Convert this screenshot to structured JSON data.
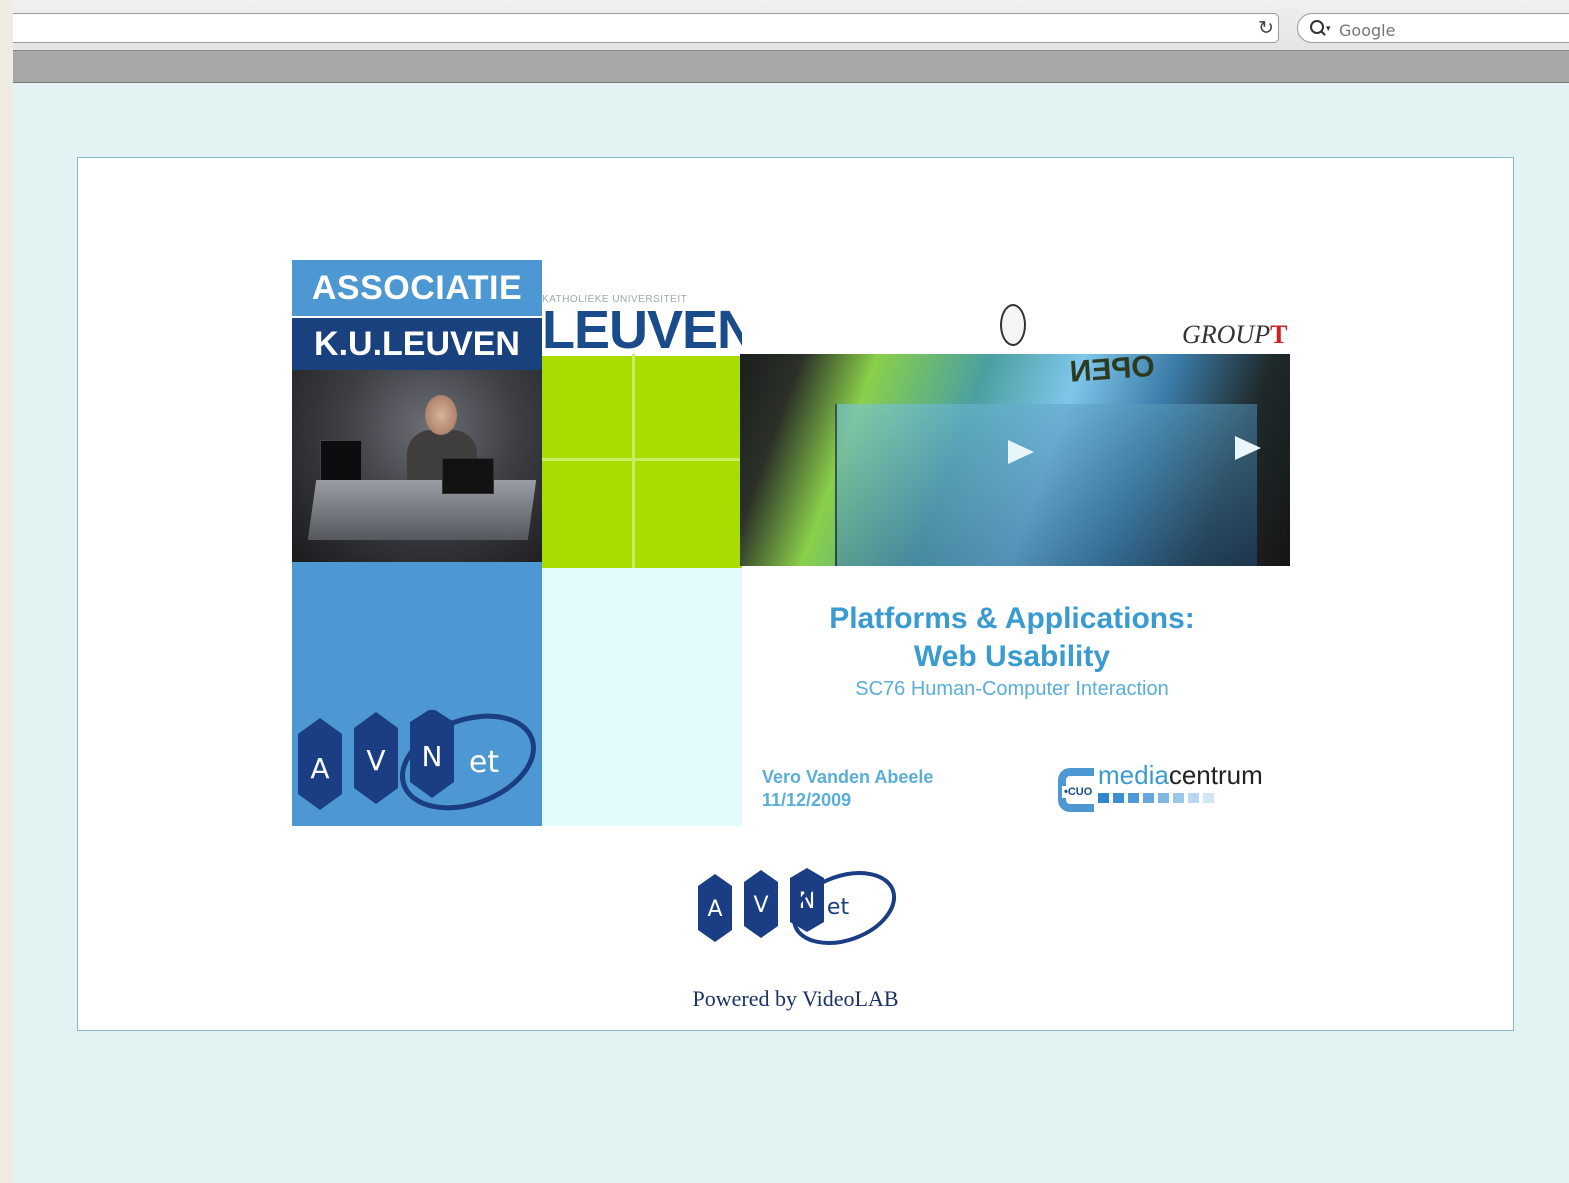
{
  "browser": {
    "url": "",
    "search": {
      "placeholder": "Google",
      "value": ""
    },
    "reload_icon": "reload-icon",
    "search_icon": "search-icon"
  },
  "slide": {
    "assoc_word": "ASSOCIATIE",
    "kul_word": "K.U.LEUVEN",
    "univ_small": "KATHOLIEKE UNIVERSITEIT",
    "univ_big": "LEUVEN",
    "photo_sign": "OPEN",
    "groupt_logo": {
      "text": "GROUP",
      "accent": "T"
    },
    "title_line1": "Platforms & Applications:",
    "title_line2": "Web Usability",
    "subtitle": "SC76 Human-Computer  Interaction",
    "presenter": "Vero Vanden Abeele",
    "date": "11/12/2009",
    "mediacentrum": {
      "media": "media",
      "centrum": "centrum",
      "cuo": "•CUO"
    },
    "avnet_logo": {
      "a": "A",
      "v": "V",
      "n": "N",
      "et": "et"
    }
  },
  "footer": {
    "avnet_logo": {
      "a": "A",
      "v": "V",
      "n": "N",
      "et": "et"
    },
    "powered_by": "Powered by VideoLAB"
  },
  "colors": {
    "page_bg": "#e3f3f3",
    "kul_dark_blue": "#18417e",
    "kul_blue": "#4d98d2",
    "lime": "#a7dd00",
    "title_blue": "#3a9bd1",
    "avnet_navy": "#1a3d84"
  }
}
